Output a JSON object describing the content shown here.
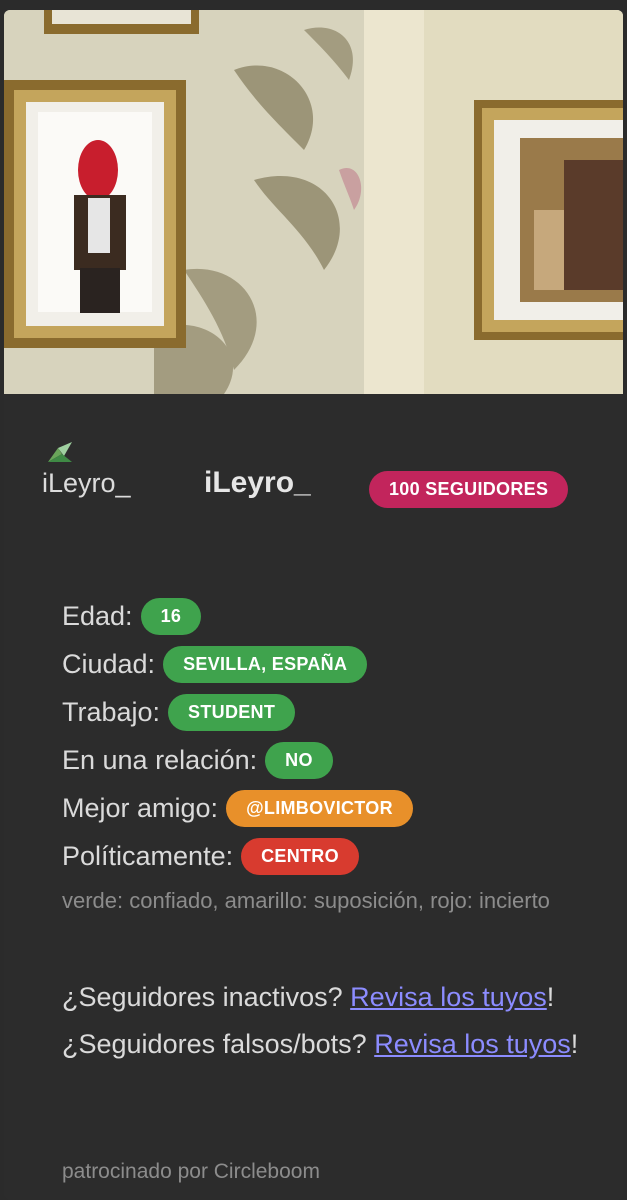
{
  "profile": {
    "username_small": "iLeyro_",
    "username": "iLeyro_",
    "followers_badge": "100 SEGUIDORES"
  },
  "facts": [
    {
      "label": "Edad:",
      "value": "16",
      "color": "#3fa34d"
    },
    {
      "label": "Ciudad:",
      "value": "SEVILLA, ESPAÑA",
      "color": "#3fa34d"
    },
    {
      "label": "Trabajo:",
      "value": "STUDENT",
      "color": "#3fa34d"
    },
    {
      "label": "En una relación:",
      "value": "NO",
      "color": "#3fa34d"
    },
    {
      "label": "Mejor amigo:",
      "value": "@LIMBOVICTOR",
      "color": "#e8902a"
    },
    {
      "label": "Políticamente:",
      "value": "CENTRO",
      "color": "#d83b2f"
    }
  ],
  "legend": "verde: confiado, amarillo: suposición, rojo: incierto",
  "promo": {
    "inactive_question": "¿Seguidores inactivos?",
    "inactive_link": "Revisa los tuyos",
    "fake_question": "¿Seguidores falsos/bots?",
    "fake_link": "Revisa los tuyos",
    "exclamation": "!"
  },
  "sponsor": "patrocinado por Circleboom",
  "colors": {
    "badge": "#c2255c",
    "link": "#8c8cff",
    "background": "#2c2c2c"
  },
  "icons": [
    "avatar-glyph-icon"
  ]
}
